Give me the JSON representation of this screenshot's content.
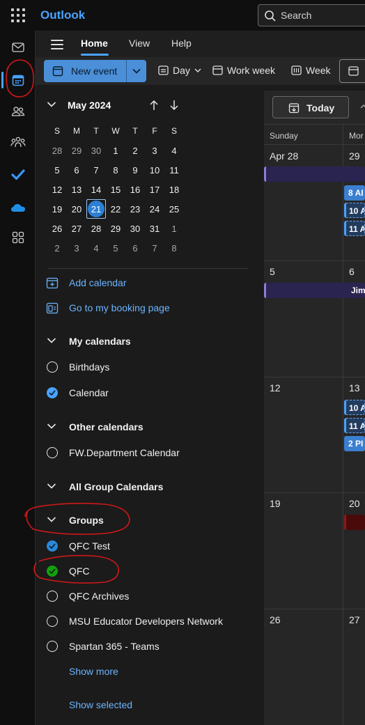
{
  "app": {
    "title": "Outlook"
  },
  "search": {
    "placeholder": "Search"
  },
  "nav_tabs": [
    {
      "label": "Home",
      "active": true
    },
    {
      "label": "View",
      "active": false
    },
    {
      "label": "Help",
      "active": false
    }
  ],
  "ribbon": {
    "new_event": "New event",
    "day": "Day",
    "work_week": "Work week",
    "week": "Week"
  },
  "mini_calendar": {
    "title": "May 2024",
    "weekdays": [
      "S",
      "M",
      "T",
      "W",
      "T",
      "F",
      "S"
    ],
    "weeks": [
      [
        {
          "d": "28",
          "dim": true
        },
        {
          "d": "29",
          "dim": true
        },
        {
          "d": "30",
          "dim": true
        },
        {
          "d": "1"
        },
        {
          "d": "2"
        },
        {
          "d": "3"
        },
        {
          "d": "4"
        }
      ],
      [
        {
          "d": "5"
        },
        {
          "d": "6"
        },
        {
          "d": "7"
        },
        {
          "d": "8"
        },
        {
          "d": "9"
        },
        {
          "d": "10"
        },
        {
          "d": "11"
        }
      ],
      [
        {
          "d": "12"
        },
        {
          "d": "13"
        },
        {
          "d": "14"
        },
        {
          "d": "15"
        },
        {
          "d": "16"
        },
        {
          "d": "17"
        },
        {
          "d": "18"
        }
      ],
      [
        {
          "d": "19"
        },
        {
          "d": "20"
        },
        {
          "d": "21",
          "today": true
        },
        {
          "d": "22"
        },
        {
          "d": "23"
        },
        {
          "d": "24"
        },
        {
          "d": "25"
        }
      ],
      [
        {
          "d": "26"
        },
        {
          "d": "27"
        },
        {
          "d": "28"
        },
        {
          "d": "29"
        },
        {
          "d": "30"
        },
        {
          "d": "31"
        },
        {
          "d": "1",
          "dim": true
        }
      ],
      [
        {
          "d": "2",
          "dim": true
        },
        {
          "d": "3",
          "dim": true
        },
        {
          "d": "4",
          "dim": true
        },
        {
          "d": "5",
          "dim": true
        },
        {
          "d": "6",
          "dim": true
        },
        {
          "d": "7",
          "dim": true
        },
        {
          "d": "8",
          "dim": true
        }
      ]
    ]
  },
  "links": {
    "add_calendar": "Add calendar",
    "booking_page": "Go to my booking page"
  },
  "sections": {
    "my_calendars": "My calendars",
    "other_calendars": "Other calendars",
    "all_group_calendars": "All Group Calendars",
    "groups": "Groups"
  },
  "my_calendars": [
    {
      "label": "Birthdays",
      "checked": false
    },
    {
      "label": "Calendar",
      "checked": true,
      "color": "#4aa3ff"
    }
  ],
  "other_calendars": [
    {
      "label": "FW.Department Calendar",
      "checked": false
    }
  ],
  "groups": [
    {
      "label": "QFC Test",
      "checked": true,
      "color": "#2b88d8"
    },
    {
      "label": "QFC",
      "checked": true,
      "color": "#13a10e"
    },
    {
      "label": "QFC Archives",
      "checked": false
    },
    {
      "label": "MSU Educator Developers Network",
      "checked": false
    },
    {
      "label": "Spartan 365 - Teams",
      "checked": false
    }
  ],
  "show_more": "Show more",
  "show_selected": "Show selected",
  "main": {
    "today_label": "Today",
    "col_headers": [
      "Sunday",
      "Mor"
    ],
    "weeks": [
      {
        "sun": "Apr 28",
        "mon": "29"
      },
      {
        "sun": "5",
        "mon": "6"
      },
      {
        "sun": "12",
        "mon": "13"
      },
      {
        "sun": "19",
        "mon": "20"
      },
      {
        "sun": "26",
        "mon": "27"
      }
    ],
    "events": {
      "w1_blue": "8 AI",
      "w1_d1": "10 A",
      "w1_d2": "11 A",
      "w2_purple": "Jim",
      "w3_d1": "10 A",
      "w3_d2": "11 A",
      "w3_blue": "2 PI"
    }
  },
  "colors": {
    "accent": "#4aa3ff",
    "new_event_bg": "#4a8fd8",
    "annotation_red": "#d01818"
  }
}
